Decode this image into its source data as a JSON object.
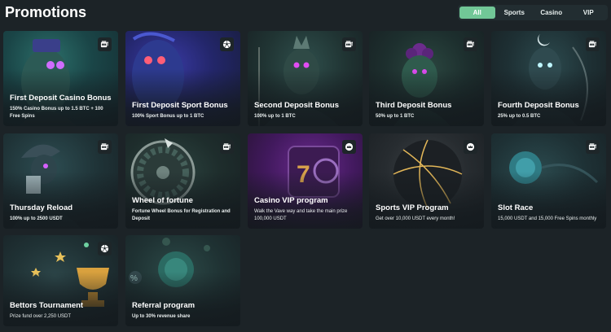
{
  "page": {
    "title": "Promotions"
  },
  "filters": [
    {
      "label": "All",
      "active": true
    },
    {
      "label": "Sports",
      "active": false
    },
    {
      "label": "Casino",
      "active": false
    },
    {
      "label": "VIP",
      "active": false
    }
  ],
  "colors": {
    "accent": "#71c797",
    "background": "#1c2327",
    "badge": "#1e2629"
  },
  "promotions": [
    {
      "title": "First Deposit Casino Bonus",
      "description": "150% Casino Bonus up to 1.5 BTC + 100 Free Spins",
      "icon": "slot-machine-icon"
    },
    {
      "title": "First Deposit Sport Bonus",
      "description": "100% Sport Bonus up to 1 BTC",
      "icon": "soccer-ball-icon"
    },
    {
      "title": "Second Deposit Bonus",
      "description": "100% up to 1 BTC",
      "icon": "slot-machine-icon"
    },
    {
      "title": "Third Deposit Bonus",
      "description": "50% up to 1 BTC",
      "icon": "slot-machine-icon"
    },
    {
      "title": "Fourth Deposit Bonus",
      "description": "25% up to 0.5 BTC",
      "icon": "slot-machine-icon"
    },
    {
      "title": "Thursday Reload",
      "description": "100% up to 2500 USDT",
      "icon": "slot-machine-icon"
    },
    {
      "title": "Wheel of fortune",
      "description": "Fortune Wheel Bonus for Registration and Deposit",
      "icon": "slot-machine-icon"
    },
    {
      "title": "Casino VIP program",
      "description": "Walk the Vave way and take the main prize 100,000 USDT",
      "icon": "crown-icon"
    },
    {
      "title": "Sports VIP Program",
      "description": "Get over 10,000 USDT every month!",
      "icon": "crown-icon"
    },
    {
      "title": "Slot Race",
      "description": "15,000 USDT and 15,000 Free Spins monthly",
      "icon": "slot-machine-icon"
    },
    {
      "title": "Bettors Tournament",
      "description": "Prize fund over 2,250 USDT",
      "icon": "soccer-ball-icon"
    },
    {
      "title": "Referral program",
      "description": "Up to 30% revenue share",
      "icon": "none"
    }
  ]
}
